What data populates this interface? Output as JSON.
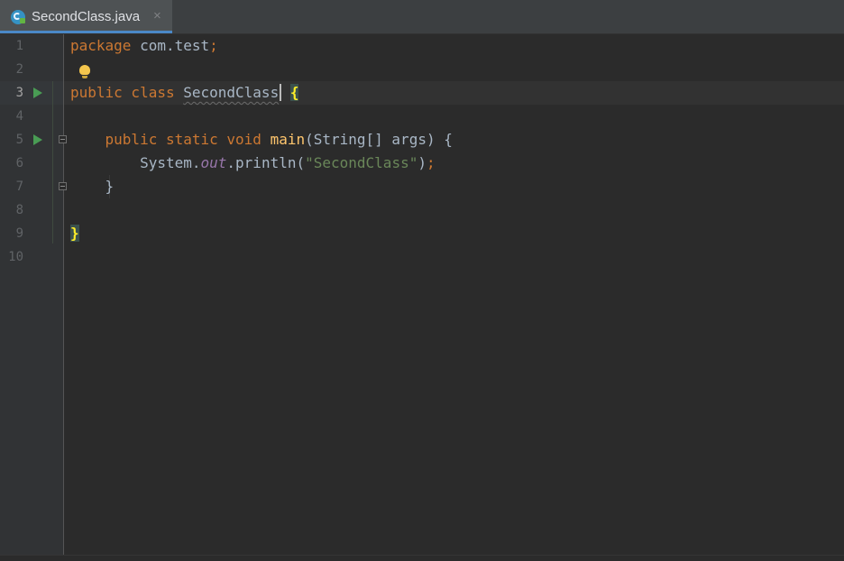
{
  "tab": {
    "label": "SecondClass.java",
    "close_glyph": "×",
    "icon": "java-class-icon",
    "accent": "#4a88c7"
  },
  "editor": {
    "lines": [
      {
        "num": "1",
        "tokens": [
          {
            "t": "package",
            "c": "kw"
          },
          {
            "t": " com.test",
            "c": ""
          },
          {
            "t": ";",
            "c": "kw"
          }
        ]
      },
      {
        "num": "2",
        "tokens": []
      },
      {
        "num": "3",
        "tokens": [
          {
            "t": "public class ",
            "c": "kw"
          },
          {
            "t": "SecondClass",
            "c": "cls-name"
          },
          {
            "t": "CURSOR",
            "c": "cursor"
          },
          {
            "t": " ",
            "c": ""
          },
          {
            "t": "{",
            "c": "brace-hl"
          }
        ]
      },
      {
        "num": "4",
        "tokens": []
      },
      {
        "num": "5",
        "tokens": [
          {
            "t": "    public static void ",
            "c": "kw"
          },
          {
            "t": "main",
            "c": "fn"
          },
          {
            "t": "(String[] args) {",
            "c": ""
          }
        ]
      },
      {
        "num": "6",
        "tokens": [
          {
            "t": "        System.",
            "c": ""
          },
          {
            "t": "out",
            "c": "st"
          },
          {
            "t": ".println(",
            "c": ""
          },
          {
            "t": "\"SecondClass\"",
            "c": "str"
          },
          {
            "t": ")",
            "c": ""
          },
          {
            "t": ";",
            "c": "kw"
          }
        ]
      },
      {
        "num": "7",
        "tokens": [
          {
            "t": "    }",
            "c": ""
          }
        ]
      },
      {
        "num": "8",
        "tokens": []
      },
      {
        "num": "9",
        "tokens": [
          {
            "t": "}",
            "c": "brace-hl"
          }
        ]
      },
      {
        "num": "10",
        "tokens": []
      }
    ],
    "active_line": "3",
    "run_markers": [
      "3",
      "5"
    ],
    "fold_markers": [
      "5",
      "7"
    ],
    "intention_icon": "lightbulb-icon"
  }
}
